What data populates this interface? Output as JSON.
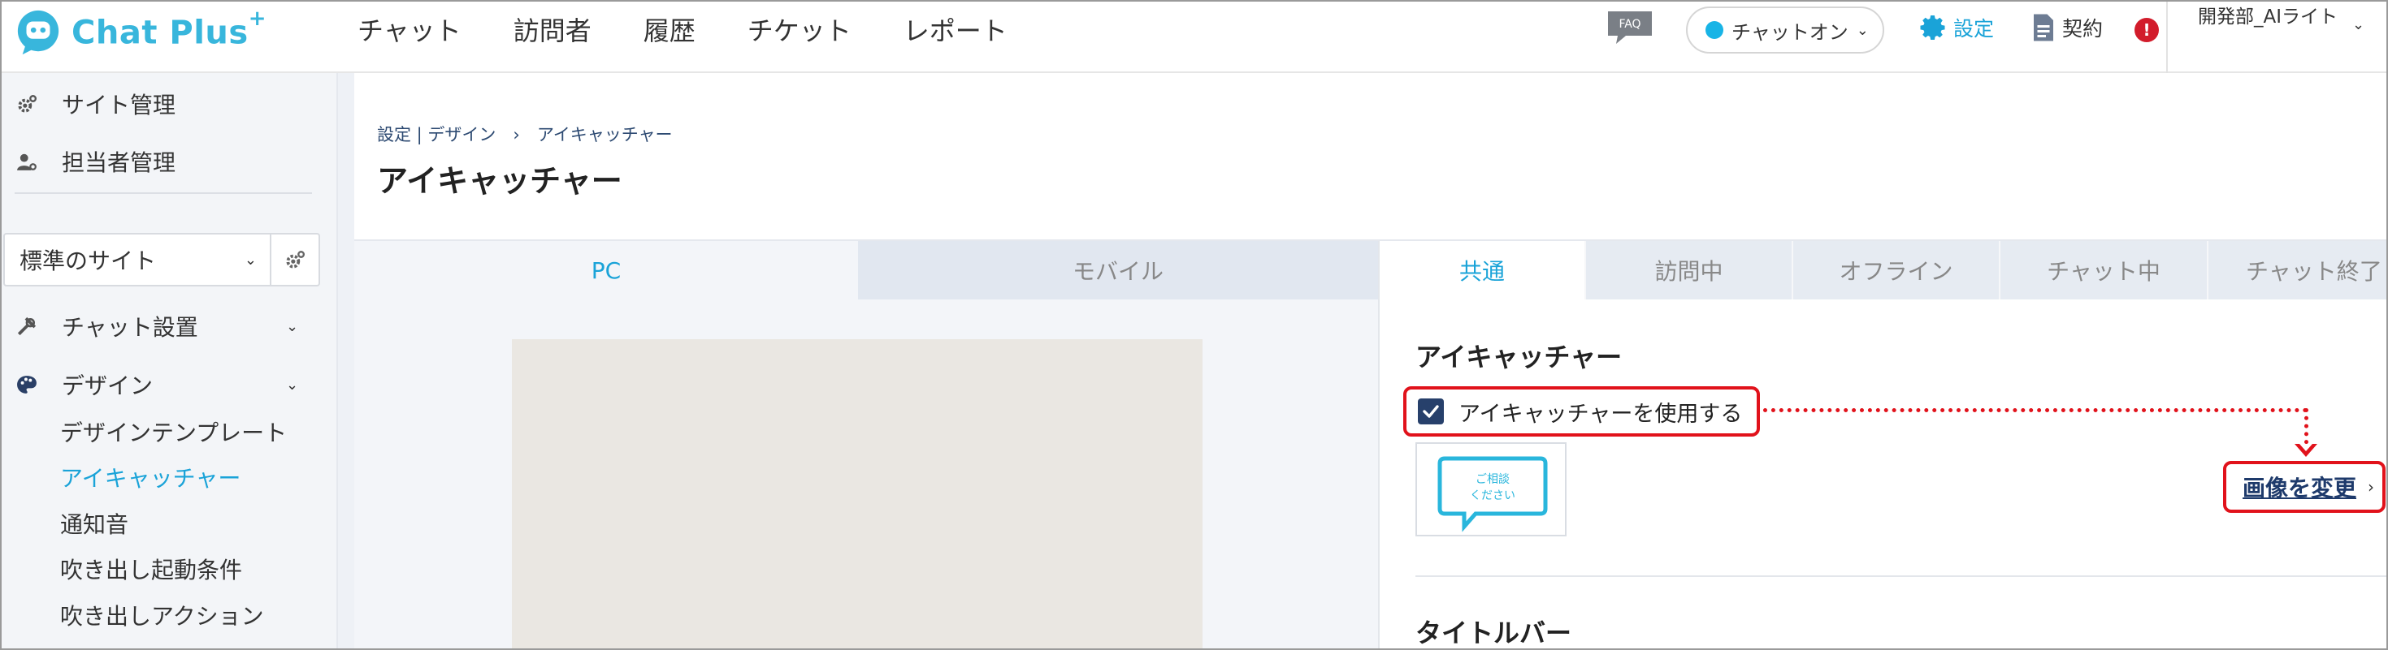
{
  "app": {
    "name": "Chat Plus",
    "name_sup": "+"
  },
  "topnav": [
    "チャット",
    "訪問者",
    "履歴",
    "チケット",
    "レポート"
  ],
  "header": {
    "faq_label": "FAQ",
    "status_label": "チャットオン",
    "settings_label": "設定",
    "contract_label": "契約",
    "alert_label": "!",
    "user_label": "開発部_AIライト",
    "colors": {
      "accent": "#1aa3d8",
      "alert": "#d21c2b",
      "status": "#18b4e6"
    }
  },
  "sidebar": {
    "top_items": [
      {
        "label": "サイト管理",
        "icon": "gear-icon"
      },
      {
        "label": "担当者管理",
        "icon": "user-gear-icon"
      }
    ],
    "site_select": "標準のサイト",
    "groups": [
      {
        "label": "チャット設置",
        "icon": "tools-icon"
      },
      {
        "label": "デザイン",
        "icon": "palette-icon"
      }
    ],
    "design_sub": [
      {
        "label": "デザインテンプレート",
        "active": false
      },
      {
        "label": "アイキャッチャー",
        "active": true
      },
      {
        "label": "通知音",
        "active": false
      },
      {
        "label": "吹き出し起動条件",
        "active": false
      },
      {
        "label": "吹き出しアクション",
        "active": false
      }
    ]
  },
  "main": {
    "breadcrumb": "設定 | デザイン　›　アイキャッチャー",
    "title": "アイキャッチャー",
    "device_tabs": [
      {
        "label": "PC",
        "active": true
      },
      {
        "label": "モバイル",
        "active": false
      }
    ],
    "state_tabs": [
      {
        "label": "共通",
        "active": true
      },
      {
        "label": "訪問中",
        "active": false
      },
      {
        "label": "オフライン",
        "active": false
      },
      {
        "label": "チャット中",
        "active": false
      },
      {
        "label": "チャット終了",
        "active": false
      }
    ],
    "eyecatcher_heading": "アイキャッチャー",
    "use_checkbox_label": "アイキャッチャーを使用する",
    "use_checkbox_checked": true,
    "thumb_text_line1": "ご相談",
    "thumb_text_line2": "ください",
    "change_image_label": "画像を変更",
    "change_image_arrow": "›",
    "titlebar_heading": "タイトルバー"
  }
}
